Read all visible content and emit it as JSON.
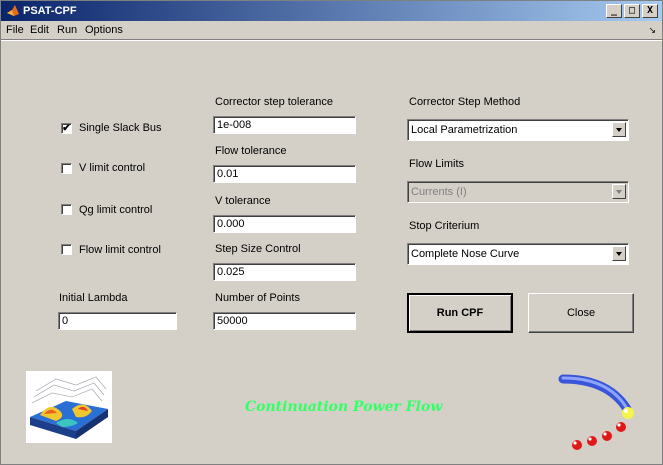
{
  "window": {
    "title": "PSAT-CPF",
    "buttons": [
      "_",
      "□",
      "X"
    ]
  },
  "menu": {
    "items": [
      "File",
      "Edit",
      "Run",
      "Options"
    ],
    "arrow": "↘"
  },
  "options": {
    "single_slack": {
      "label": "Single Slack Bus",
      "checked": true,
      "mark": "✔"
    },
    "v_limit": {
      "label": "V limit control",
      "checked": false
    },
    "qg_limit": {
      "label": "Qg limit control",
      "checked": false
    },
    "flow_limit": {
      "label": "Flow limit control",
      "checked": false
    }
  },
  "initial_lambda": {
    "label": "Initial Lambda",
    "value": "0"
  },
  "fields": {
    "corrector_tol": {
      "label": "Corrector step tolerance",
      "value": "1e-008"
    },
    "flow_tol": {
      "label": "Flow tolerance",
      "value": "0.01"
    },
    "v_tol": {
      "label": "V tolerance",
      "value": "0.000"
    },
    "step_size": {
      "label": "Step Size Control",
      "value": "0.025"
    },
    "num_points": {
      "label": "Number of Points",
      "value": "50000"
    }
  },
  "selects": {
    "method": {
      "label": "Corrector Step Method",
      "value": "Local Parametrization"
    },
    "flow_limits": {
      "label": "Flow Limits",
      "value": "Currents (I)",
      "disabled": true
    },
    "stop": {
      "label": "Stop Criterium",
      "value": "Complete Nose Curve"
    }
  },
  "buttons": {
    "run": "Run CPF",
    "close": "Close"
  },
  "banner": "Continuation Power Flow",
  "colors": {
    "banner": "#33ff66",
    "title_start": "#0a246a",
    "title_end": "#a6caf0"
  }
}
